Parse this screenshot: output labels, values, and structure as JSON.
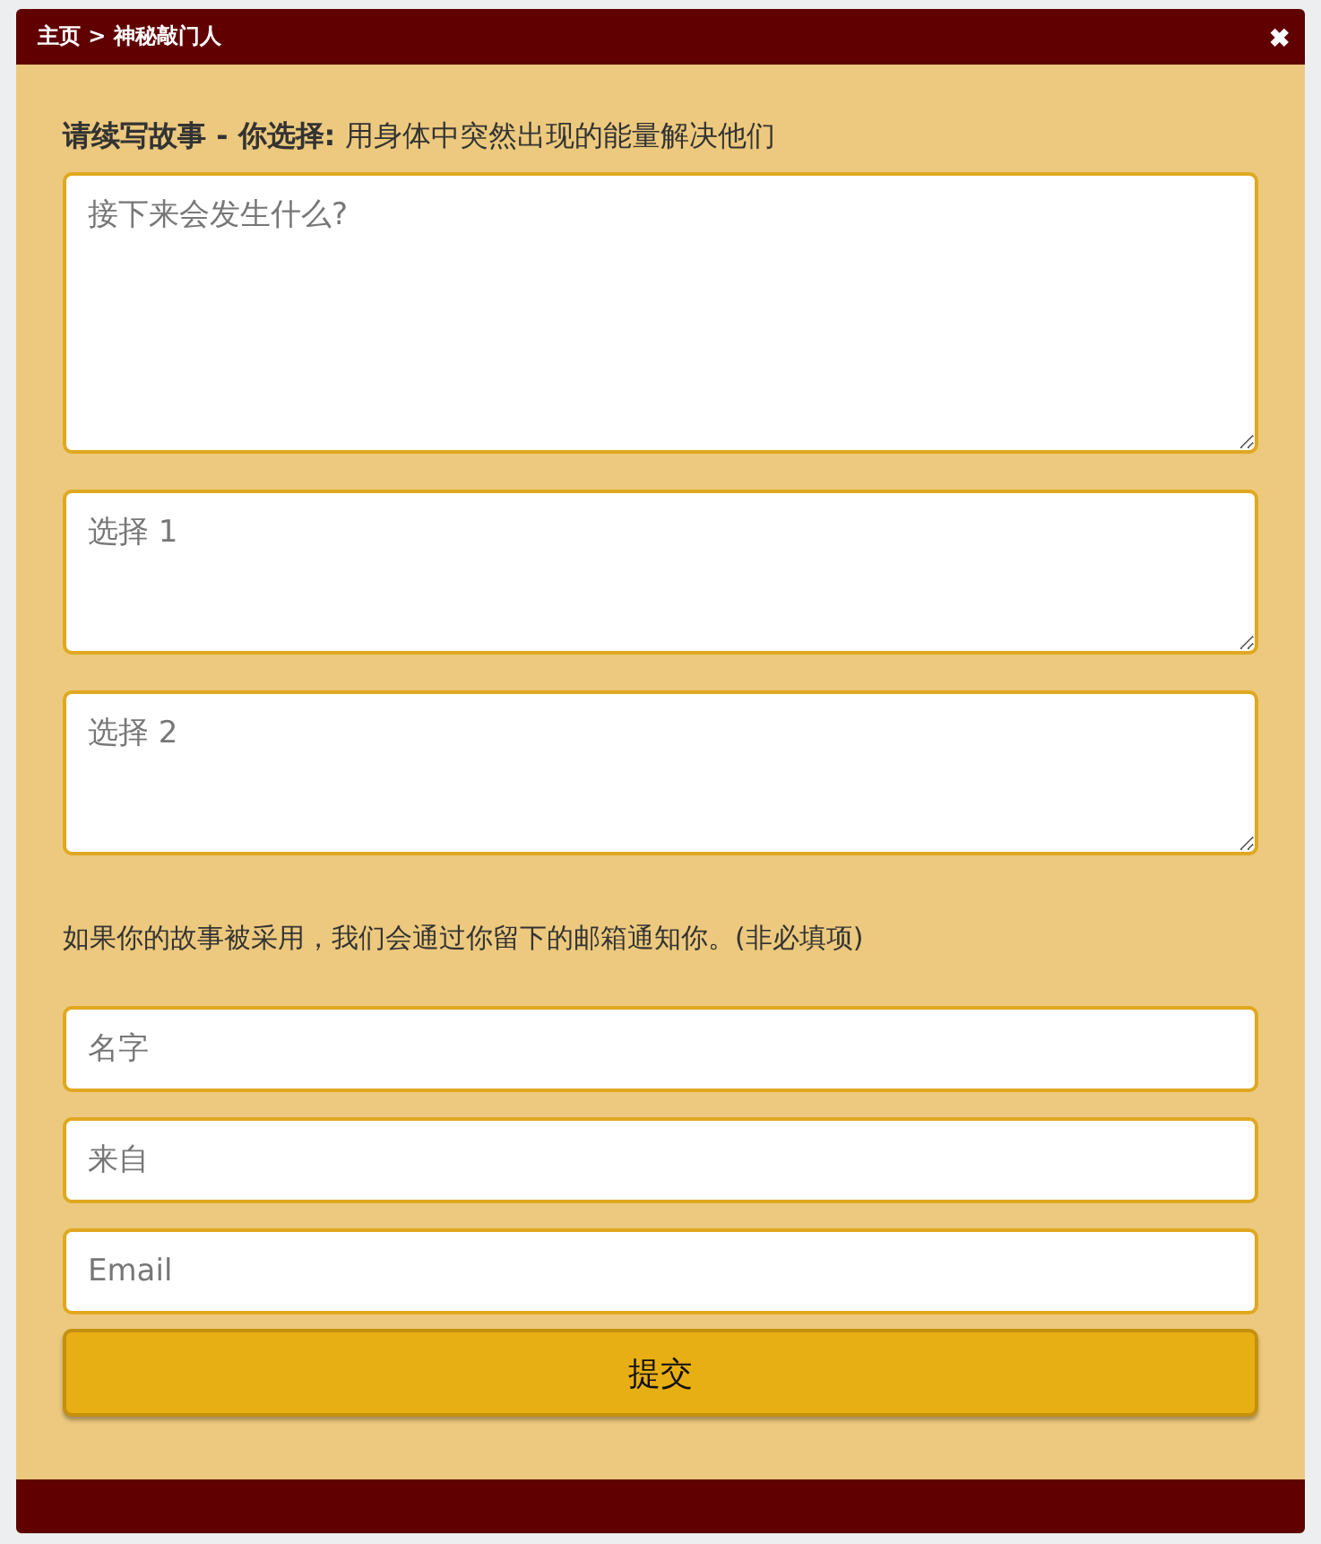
{
  "header": {
    "breadcrumb": "主页 > 神秘敲门人",
    "close": "✖"
  },
  "prompt": "**请续写故事 - 你选择:** 用身体中突然出现的能量解决他们",
  "story_fields": [
    {
      "kind": "story",
      "placeholder": "接下来会发生什么?"
    },
    {
      "kind": "choice",
      "placeholder": "选择 1"
    },
    {
      "kind": "choice",
      "placeholder": "选择 2"
    }
  ],
  "notice": "如果你的故事被采用，我们会通过你留下的邮箱通知你。(非必填项)",
  "contact_fields": [
    {
      "placeholder": "名字"
    },
    {
      "placeholder": "来自"
    },
    {
      "placeholder": "Email"
    }
  ],
  "submit": "提交"
}
